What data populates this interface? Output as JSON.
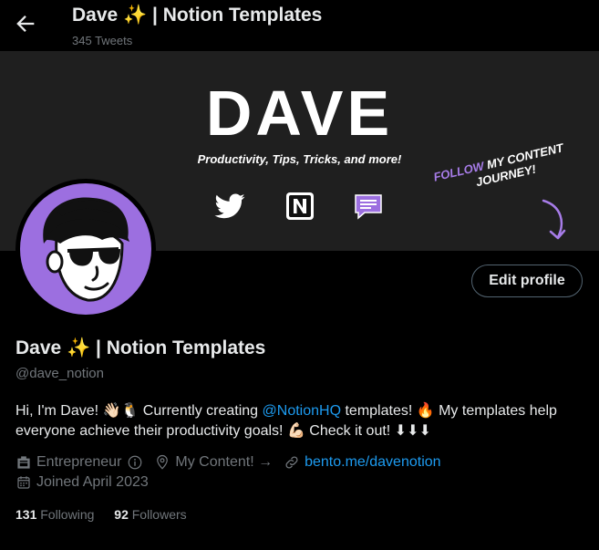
{
  "header": {
    "title": "Dave ✨ | Notion Templates",
    "subtitle": "345 Tweets"
  },
  "banner": {
    "title": "DAVE",
    "tagline": "Productivity, Tips, Tricks, and more!",
    "follow_note_accent": "FOLLOW",
    "follow_note_rest_line1": " MY CONTENT",
    "follow_note_line2": "JOURNEY!",
    "accent_color": "#a77ce8"
  },
  "profile": {
    "edit_label": "Edit profile",
    "name": "Dave ✨ | Notion Templates",
    "handle": "@dave_notion",
    "bio_part1": "Hi, I'm Dave! 👋🏻🐧  Currently creating ",
    "bio_mention": "@NotionHQ",
    "bio_part2": " templates! 🔥 My templates help everyone achieve their productivity goals! 💪🏻 Check it out! ⬇⬇⬇",
    "category": "Entrepreneur",
    "location": "My Content! →",
    "website": "bento.me/davenotion",
    "joined": "Joined April 2023",
    "following_count": "131",
    "following_label": "Following",
    "followers_count": "92",
    "followers_label": "Followers",
    "avatar_color": "#9c6fe0",
    "link_color": "#1d9bf0"
  }
}
